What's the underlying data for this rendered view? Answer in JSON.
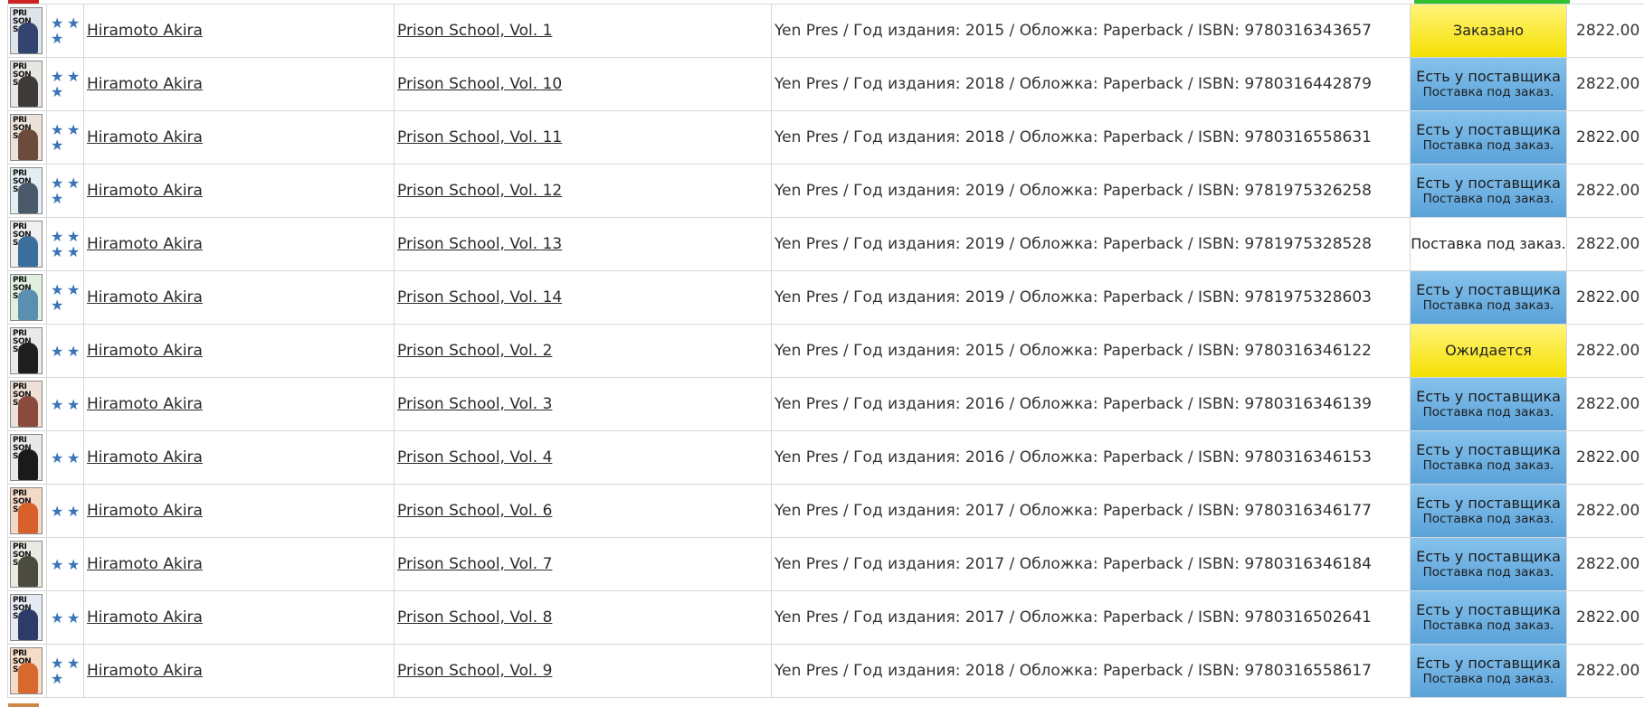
{
  "colors": {
    "star": "#3a74b5",
    "status_blue": "#6fb1e3",
    "status_yellow": "#f8e80e",
    "ordered_bar": "#2fbf2f"
  },
  "icons": {
    "rating": "star-icon"
  },
  "rows": [
    {
      "author": "Hiramoto Akira",
      "title": "Prison School, Vol. 1",
      "info": "Yen Pres / Год издания: 2015 / Обложка: Paperback / ISBN: 9780316343657",
      "stars": 3,
      "status": "yellow",
      "status_line1": "Заказано",
      "status_line2": "",
      "price": "2822.00",
      "cover_bg": "#dfe3ea",
      "cover_fig": "#33456e"
    },
    {
      "author": "Hiramoto Akira",
      "title": "Prison School, Vol. 10",
      "info": "Yen Pres / Год издания: 2018 / Обложка: Paperback / ISBN: 9780316442879",
      "stars": 3,
      "status": "blue",
      "status_line1": "Есть у поставщика",
      "status_line2": "Поставка под заказ.",
      "price": "2822.00",
      "cover_bg": "#e8e6e2",
      "cover_fig": "#3e3a3a"
    },
    {
      "author": "Hiramoto Akira",
      "title": "Prison School, Vol. 11",
      "info": "Yen Pres / Год издания: 2018 / Обложка: Paperback / ISBN: 9780316558631",
      "stars": 3,
      "status": "blue",
      "status_line1": "Есть у поставщика",
      "status_line2": "Поставка под заказ.",
      "price": "2822.00",
      "cover_bg": "#ebe3da",
      "cover_fig": "#6b4b3a"
    },
    {
      "author": "Hiramoto Akira",
      "title": "Prison School, Vol. 12",
      "info": "Yen Pres / Год издания: 2019 / Обложка: Paperback / ISBN: 9781975326258",
      "stars": 3,
      "status": "blue",
      "status_line1": "Есть у поставщика",
      "status_line2": "Поставка под заказ.",
      "price": "2822.00",
      "cover_bg": "#e4eef2",
      "cover_fig": "#4a5a6a"
    },
    {
      "author": "Hiramoto Akira",
      "title": "Prison School, Vol. 13",
      "info": "Yen Pres / Год издания: 2019 / Обложка: Paperback / ISBN: 9781975328528",
      "stars": 4,
      "status": "plain",
      "status_line1": "Поставка под заказ.",
      "status_line2": "",
      "price": "2822.00",
      "cover_bg": "#eef0f2",
      "cover_fig": "#3b6e9a"
    },
    {
      "author": "Hiramoto Akira",
      "title": "Prison School, Vol. 14",
      "info": "Yen Pres / Год издания: 2019 / Обложка: Paperback / ISBN: 9781975328603",
      "stars": 3,
      "status": "blue",
      "status_line1": "Есть у поставщика",
      "status_line2": "Поставка под заказ.",
      "price": "2822.00",
      "cover_bg": "#dff0df",
      "cover_fig": "#5a8fb0"
    },
    {
      "author": "Hiramoto Akira",
      "title": "Prison School, Vol. 2",
      "info": "Yen Pres / Год издания: 2015 / Обложка: Paperback / ISBN: 9780316346122",
      "stars": 2,
      "status": "yellow",
      "status_line1": "Ожидается",
      "status_line2": "",
      "price": "2822.00",
      "cover_bg": "#e9e9e9",
      "cover_fig": "#1e1e1e"
    },
    {
      "author": "Hiramoto Akira",
      "title": "Prison School, Vol. 3",
      "info": "Yen Pres / Год издания: 2016 / Обложка: Paperback / ISBN: 9780316346139",
      "stars": 2,
      "status": "blue",
      "status_line1": "Есть у поставщика",
      "status_line2": "Поставка под заказ.",
      "price": "2822.00",
      "cover_bg": "#efe0d8",
      "cover_fig": "#8a4b3c"
    },
    {
      "author": "Hiramoto Akira",
      "title": "Prison School, Vol. 4",
      "info": "Yen Pres / Год издания: 2016 / Обложка: Paperback / ISBN: 9780316346153",
      "stars": 2,
      "status": "blue",
      "status_line1": "Есть у поставщика",
      "status_line2": "Поставка под заказ.",
      "price": "2822.00",
      "cover_bg": "#e8e8e8",
      "cover_fig": "#1a1a1a"
    },
    {
      "author": "Hiramoto Akira",
      "title": "Prison School, Vol. 6",
      "info": "Yen Pres / Год издания: 2017 / Обложка: Paperback / ISBN: 9780316346177",
      "stars": 2,
      "status": "blue",
      "status_line1": "Есть у поставщика",
      "status_line2": "Поставка под заказ.",
      "price": "2822.00",
      "cover_bg": "#f3d9c8",
      "cover_fig": "#d8602a"
    },
    {
      "author": "Hiramoto Akira",
      "title": "Prison School, Vol. 7",
      "info": "Yen Pres / Год издания: 2017 / Обложка: Paperback / ISBN: 9780316346184",
      "stars": 2,
      "status": "blue",
      "status_line1": "Есть у поставщика",
      "status_line2": "Поставка под заказ.",
      "price": "2822.00",
      "cover_bg": "#eaeae3",
      "cover_fig": "#4c4c3e"
    },
    {
      "author": "Hiramoto Akira",
      "title": "Prison School, Vol. 8",
      "info": "Yen Pres / Год издания: 2017 / Обложка: Paperback / ISBN: 9780316502641",
      "stars": 2,
      "status": "blue",
      "status_line1": "Есть у поставщика",
      "status_line2": "Поставка под заказ.",
      "price": "2822.00",
      "cover_bg": "#e5e9f1",
      "cover_fig": "#2c3c66"
    },
    {
      "author": "Hiramoto Akira",
      "title": "Prison School, Vol. 9",
      "info": "Yen Pres / Год издания: 2018 / Обложка: Paperback / ISBN: 9780316558617",
      "stars": 3,
      "status": "blue",
      "status_line1": "Есть у поставщика",
      "status_line2": "Поставка под заказ.",
      "price": "2822.00",
      "cover_bg": "#f4dcc8",
      "cover_fig": "#d8692e"
    }
  ]
}
